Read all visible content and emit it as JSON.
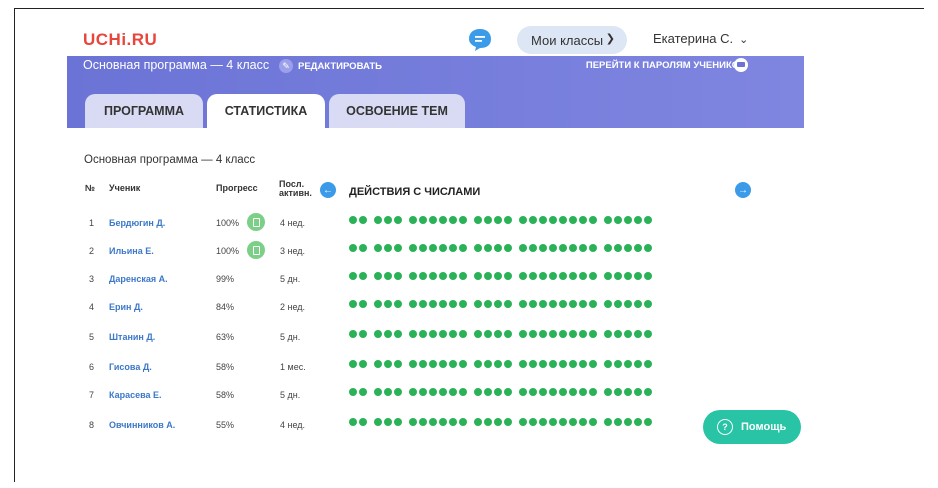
{
  "header": {
    "logo": "UCHi.RU",
    "classes_button": "Мои классы",
    "user_name": "Екатерина С."
  },
  "banner": {
    "program_title": "Основная программа — 4 класс",
    "edit_label": "РЕДАКТИРОВАТЬ",
    "passwords_link": "ПЕРЕЙТИ К ПАРОЛЯМ УЧЕНИКОВ"
  },
  "tabs": [
    {
      "label": "ПРОГРАММА",
      "active": false
    },
    {
      "label": "СТАТИСТИКА",
      "active": true
    },
    {
      "label": "ОСВОЕНИЕ ТЕМ",
      "active": false
    }
  ],
  "table": {
    "subtitle": "Основная программа — 4 класс",
    "headers": {
      "no": "№",
      "student": "Ученик",
      "progress": "Прогресс",
      "last_line1": "Посл.",
      "last_line2": "активн."
    },
    "topic": "ДЕЙСТВИЯ С ЧИСЛАМИ",
    "dot_groups": [
      2,
      3,
      6,
      4,
      8,
      5
    ],
    "rows": [
      {
        "num": "1",
        "name": "Бердюгин Д.",
        "progress": "100%",
        "report": true,
        "last": "4 нед."
      },
      {
        "num": "2",
        "name": "Ильина Е.",
        "progress": "100%",
        "report": true,
        "last": "3 нед."
      },
      {
        "num": "3",
        "name": "Даренская А.",
        "progress": "99%",
        "report": false,
        "last": "5 дн."
      },
      {
        "num": "4",
        "name": "Ерин Д.",
        "progress": "84%",
        "report": false,
        "last": "2 нед."
      },
      {
        "num": "5",
        "name": "Штанин Д.",
        "progress": "63%",
        "report": false,
        "last": "5 дн."
      },
      {
        "num": "6",
        "name": "Гисова Д.",
        "progress": "58%",
        "report": false,
        "last": "1 мес."
      },
      {
        "num": "7",
        "name": "Карасева Е.",
        "progress": "58%",
        "report": false,
        "last": "5 дн."
      },
      {
        "num": "8",
        "name": "Овчинников А.",
        "progress": "55%",
        "report": false,
        "last": "4 нед."
      }
    ]
  },
  "help_button": "Помощь",
  "colors": {
    "brand": "#e8453c",
    "banner": "#6b73d6",
    "dot": "#2bb259",
    "help": "#29c4a6",
    "link": "#3b78c8"
  }
}
